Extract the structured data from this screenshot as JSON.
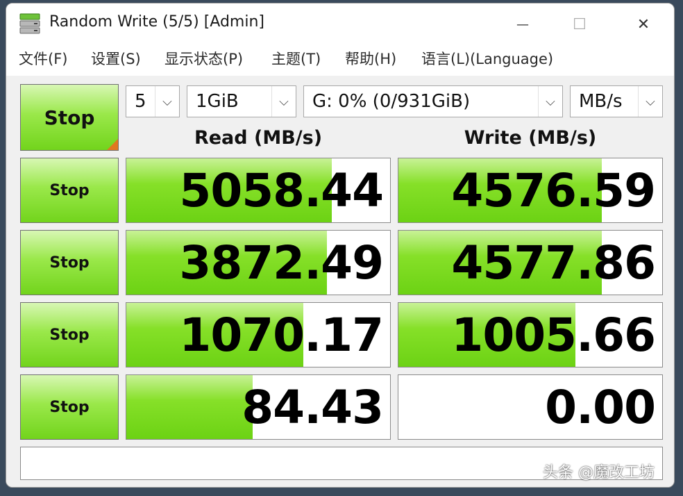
{
  "window": {
    "title": "Random Write (5/5) [Admin]",
    "controls": {
      "minimize": "—",
      "maximize": "☐",
      "close": "✕"
    }
  },
  "menu": [
    "文件(F)",
    "设置(S)",
    "显示状态(P)",
    "主题(T)",
    "帮助(H)",
    "语言(L)(Language)"
  ],
  "main_button": "Stop",
  "selectors": {
    "count": "5",
    "size": "1GiB",
    "drive": "G: 0% (0/931GiB)",
    "unit": "MB/s",
    "arrow": "⌵"
  },
  "headers": {
    "read": "Read (MB/s)",
    "write": "Write (MB/s)"
  },
  "rows": [
    {
      "button": "Stop",
      "read": "5058.44",
      "write": "4576.59",
      "read_fill": 0.78,
      "write_fill": 0.77
    },
    {
      "button": "Stop",
      "read": "3872.49",
      "write": "4577.86",
      "read_fill": 0.76,
      "write_fill": 0.77
    },
    {
      "button": "Stop",
      "read": "1070.17",
      "write": "1005.66",
      "read_fill": 0.67,
      "write_fill": 0.67
    },
    {
      "button": "Stop",
      "read": "84.43",
      "write": "0.00",
      "read_fill": 0.48,
      "write_fill": 0.0
    }
  ],
  "comment": "",
  "watermark": "头条 @魔改工坊",
  "colors": {
    "accent_green": "#7ad823",
    "corner_orange": "#e07820"
  }
}
